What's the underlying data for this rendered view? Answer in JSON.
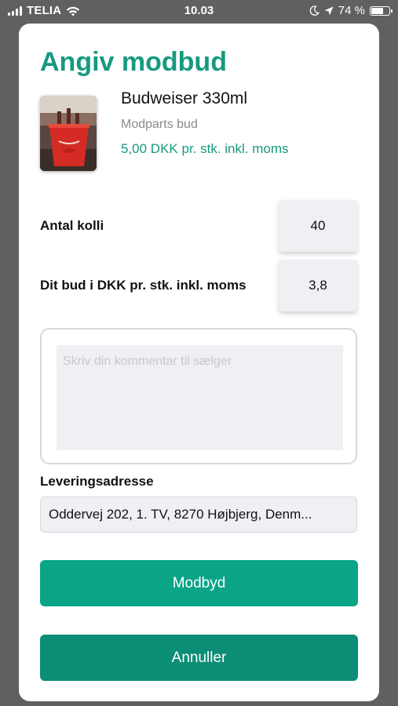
{
  "status_bar": {
    "carrier": "TELIA",
    "time": "10.03",
    "battery_text": "74 %",
    "battery_level": 0.74,
    "icons": [
      "signal-icon",
      "wifi-icon",
      "moon-icon",
      "location-icon",
      "battery-icon"
    ]
  },
  "modal": {
    "title": "Angiv modbud",
    "product": {
      "name": "Budweiser 330ml",
      "subtitle": "Modparts bud",
      "price": "5,00 DKK pr. stk. inkl. moms"
    },
    "quantity": {
      "label": "Antal kolli",
      "value": "40"
    },
    "bid": {
      "label": "Dit bud i DKK pr. stk. inkl. moms",
      "value": "3,8"
    },
    "comment": {
      "placeholder": "Skriv din kommentar til sælger",
      "value": ""
    },
    "address": {
      "label": "Leveringsadresse",
      "value": "Oddervej 202, 1. TV, 8270 Højbjerg, Denm..."
    },
    "buttons": {
      "submit": "Modbyd",
      "cancel": "Annuller"
    }
  },
  "colors": {
    "accent": "#169a7f",
    "button_primary": "#0aa487",
    "button_secondary": "#0c8e76",
    "backdrop": "#5f6062",
    "field_bg": "#efeff4"
  }
}
